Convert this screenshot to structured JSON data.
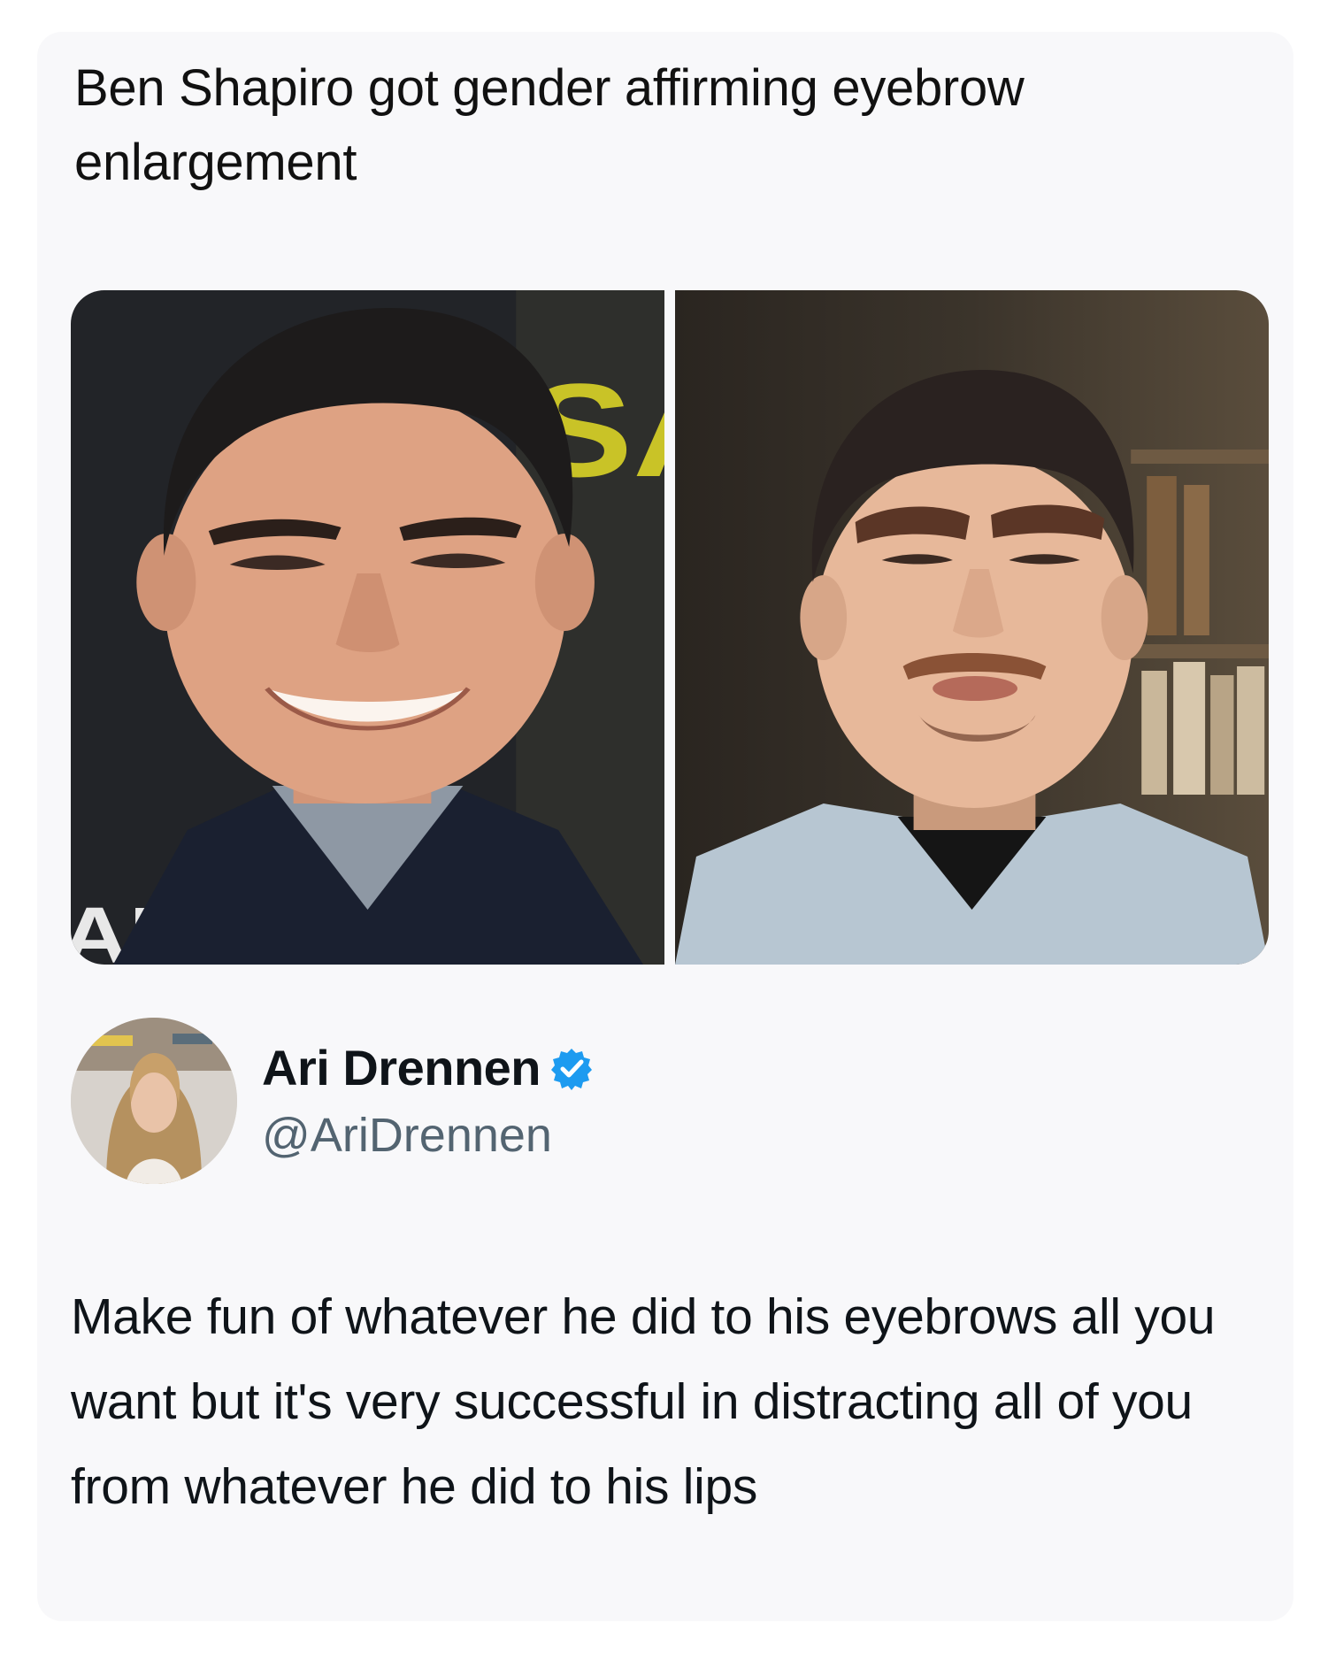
{
  "post": {
    "caption": "Ben Shapiro got gender affirming eyebrow enlargement"
  },
  "media": {
    "left_photo_sign_text": "SAF",
    "left_photo_corner_text": "AL"
  },
  "tweet": {
    "author_name": "Ari Drennen",
    "author_handle": "@AriDrennen",
    "verified": true,
    "text": "Make fun of whatever he did to his eyebrows all you want but it's very successful in distracting all of you from whatever he did to his lips"
  },
  "colors": {
    "background": "#ffffff",
    "card": "#f8f8fa",
    "text_primary": "#0f1419",
    "text_secondary": "#536471",
    "verified_badge": "#1d9bf0"
  },
  "icons": {
    "verified": "verified-badge-icon"
  }
}
